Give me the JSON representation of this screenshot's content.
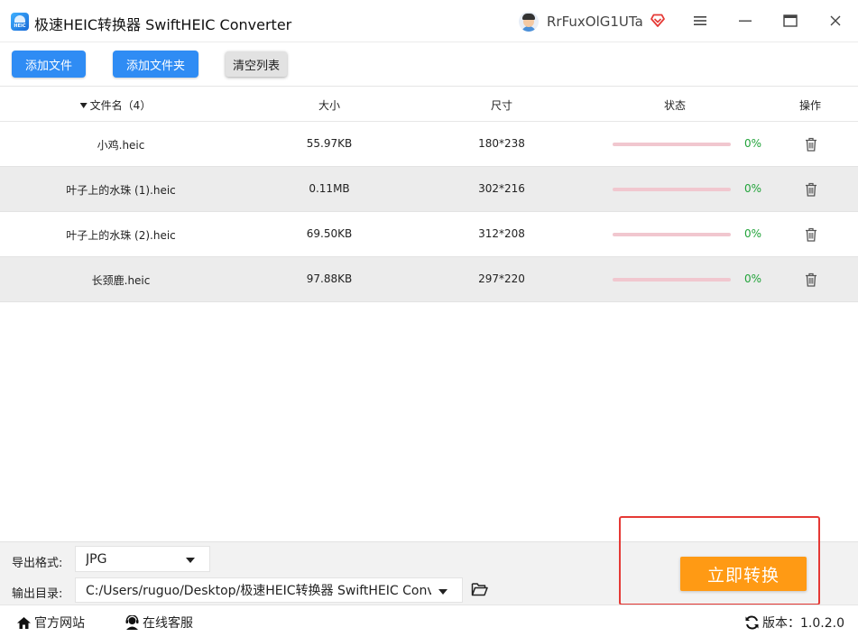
{
  "window": {
    "title": "极速HEIC转换器 SwiftHEIC Converter",
    "logo_text": "HEIC",
    "username": "RrFuxOlG1UTa"
  },
  "toolbar": {
    "add_file": "添加文件",
    "add_folder": "添加文件夹",
    "clear_list": "清空列表"
  },
  "table": {
    "headers": {
      "name": "文件名（4）",
      "size": "大小",
      "dimensions": "尺寸",
      "status": "状态",
      "action": "操作"
    },
    "rows": [
      {
        "name": "小鸡.heic",
        "size": "55.97KB",
        "dimensions": "180*238",
        "progress_percent": 0,
        "status": "0%"
      },
      {
        "name": "叶子上的水珠 (1).heic",
        "size": "0.11MB",
        "dimensions": "302*216",
        "progress_percent": 0,
        "status": "0%"
      },
      {
        "name": "叶子上的水珠 (2).heic",
        "size": "69.50KB",
        "dimensions": "312*208",
        "progress_percent": 0,
        "status": "0%"
      },
      {
        "name": "长颈鹿.heic",
        "size": "97.88KB",
        "dimensions": "297*220",
        "progress_percent": 0,
        "status": "0%"
      }
    ]
  },
  "options": {
    "format_label": "导出格式:",
    "format_value": "JPG",
    "dir_label": "输出目录:",
    "dir_value": "C:/Users/ruguo/Desktop/极速HEIC转换器 SwiftHEIC Converter"
  },
  "actions": {
    "convert": "立即转换"
  },
  "statusbar": {
    "website": "官方网站",
    "service": "在线客服",
    "version": "版本：1.0.2.0"
  },
  "colors": {
    "primary_blue": "#2f8cf4",
    "convert_orange": "#ff9a14",
    "progress_track": "#f1c7cf",
    "percent_green": "#22a33a",
    "highlight_red": "#e53935"
  }
}
